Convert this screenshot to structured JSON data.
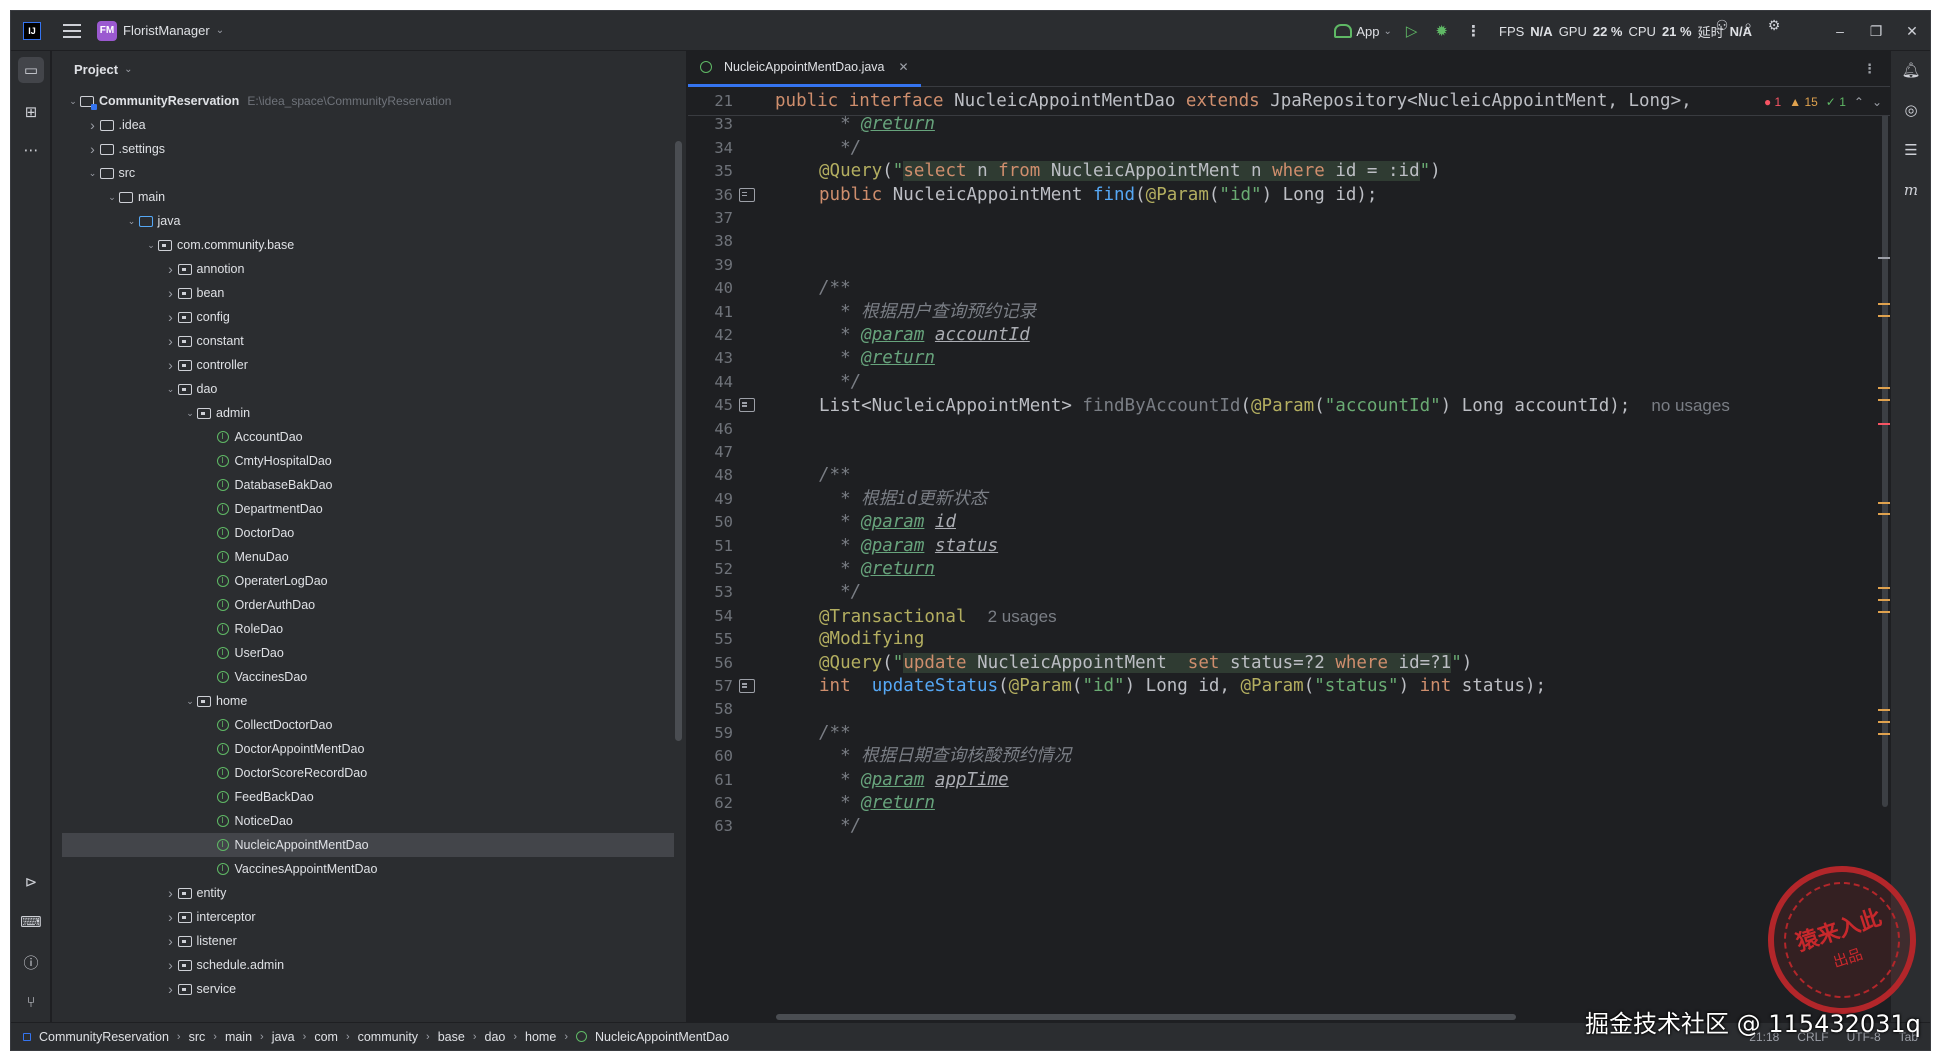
{
  "titlebar": {
    "logo_text": "IJ",
    "project_badge": "FM",
    "project_name": "FloristManager",
    "run_config": "App",
    "stats": {
      "fps_label": "FPS",
      "fps_value": "N/A",
      "gpu_label": "GPU",
      "gpu_value": "22 %",
      "cpu_label": "CPU",
      "cpu_value": "21 %",
      "latency_label": "延时",
      "latency_value": "N/A"
    }
  },
  "project_panel": {
    "title": "Project",
    "tree": [
      {
        "depth": 0,
        "arrow": "open",
        "icon": "module",
        "label": "CommunityReservation",
        "hint": "E:\\idea_space\\CommunityReservation",
        "bold": true
      },
      {
        "depth": 1,
        "arrow": "closed",
        "icon": "folder",
        "label": ".idea"
      },
      {
        "depth": 1,
        "arrow": "closed",
        "icon": "folder",
        "label": ".settings"
      },
      {
        "depth": 1,
        "arrow": "open",
        "icon": "folder",
        "label": "src"
      },
      {
        "depth": 2,
        "arrow": "open",
        "icon": "folder",
        "label": "main"
      },
      {
        "depth": 3,
        "arrow": "open",
        "icon": "source",
        "label": "java"
      },
      {
        "depth": 4,
        "arrow": "open",
        "icon": "package",
        "label": "com.community.base"
      },
      {
        "depth": 5,
        "arrow": "closed",
        "icon": "package",
        "label": "annotion"
      },
      {
        "depth": 5,
        "arrow": "closed",
        "icon": "package",
        "label": "bean"
      },
      {
        "depth": 5,
        "arrow": "closed",
        "icon": "package",
        "label": "config"
      },
      {
        "depth": 5,
        "arrow": "closed",
        "icon": "package",
        "label": "constant"
      },
      {
        "depth": 5,
        "arrow": "closed",
        "icon": "package",
        "label": "controller"
      },
      {
        "depth": 5,
        "arrow": "open",
        "icon": "package",
        "label": "dao"
      },
      {
        "depth": 6,
        "arrow": "open",
        "icon": "package",
        "label": "admin"
      },
      {
        "depth": 7,
        "arrow": "none",
        "icon": "interface",
        "label": "AccountDao"
      },
      {
        "depth": 7,
        "arrow": "none",
        "icon": "interface",
        "label": "CmtyHospitalDao"
      },
      {
        "depth": 7,
        "arrow": "none",
        "icon": "interface",
        "label": "DatabaseBakDao"
      },
      {
        "depth": 7,
        "arrow": "none",
        "icon": "interface",
        "label": "DepartmentDao"
      },
      {
        "depth": 7,
        "arrow": "none",
        "icon": "interface",
        "label": "DoctorDao"
      },
      {
        "depth": 7,
        "arrow": "none",
        "icon": "interface",
        "label": "MenuDao"
      },
      {
        "depth": 7,
        "arrow": "none",
        "icon": "interface",
        "label": "OperaterLogDao"
      },
      {
        "depth": 7,
        "arrow": "none",
        "icon": "interface",
        "label": "OrderAuthDao"
      },
      {
        "depth": 7,
        "arrow": "none",
        "icon": "interface",
        "label": "RoleDao"
      },
      {
        "depth": 7,
        "arrow": "none",
        "icon": "interface",
        "label": "UserDao"
      },
      {
        "depth": 7,
        "arrow": "none",
        "icon": "interface",
        "label": "VaccinesDao"
      },
      {
        "depth": 6,
        "arrow": "open",
        "icon": "package",
        "label": "home"
      },
      {
        "depth": 7,
        "arrow": "none",
        "icon": "interface",
        "label": "CollectDoctorDao"
      },
      {
        "depth": 7,
        "arrow": "none",
        "icon": "interface",
        "label": "DoctorAppointMentDao"
      },
      {
        "depth": 7,
        "arrow": "none",
        "icon": "interface",
        "label": "DoctorScoreRecordDao"
      },
      {
        "depth": 7,
        "arrow": "none",
        "icon": "interface",
        "label": "FeedBackDao"
      },
      {
        "depth": 7,
        "arrow": "none",
        "icon": "interface",
        "label": "NoticeDao"
      },
      {
        "depth": 7,
        "arrow": "none",
        "icon": "interface",
        "label": "NucleicAppointMentDao",
        "selected": true
      },
      {
        "depth": 7,
        "arrow": "none",
        "icon": "interface",
        "label": "VaccinesAppointMentDao"
      },
      {
        "depth": 5,
        "arrow": "closed",
        "icon": "package",
        "label": "entity"
      },
      {
        "depth": 5,
        "arrow": "closed",
        "icon": "package",
        "label": "interceptor"
      },
      {
        "depth": 5,
        "arrow": "closed",
        "icon": "package",
        "label": "listener"
      },
      {
        "depth": 5,
        "arrow": "closed",
        "icon": "package",
        "label": "schedule.admin"
      },
      {
        "depth": 5,
        "arrow": "closed",
        "icon": "package",
        "label": "service"
      }
    ]
  },
  "editor": {
    "tab_label": "NucleicAppointMentDao.java",
    "inspections": {
      "errors": "1",
      "warnings": "15",
      "ok": "1"
    },
    "lines": [
      {
        "n": "21",
        "sticky": true,
        "segs": [
          [
            "kw",
            "public interface "
          ],
          [
            "",
            "NucleicAppointMentDao "
          ],
          [
            "kw",
            "extends "
          ],
          [
            "",
            "JpaRepository<NucleicAppointMent, Long>, "
          ]
        ]
      },
      {
        "n": "33",
        "segs": [
          [
            "cmt",
            "  * "
          ],
          [
            "doctag",
            "@return"
          ]
        ]
      },
      {
        "n": "34",
        "segs": [
          [
            "cmt",
            "  */"
          ]
        ]
      },
      {
        "n": "35",
        "segs": [
          [
            "ann",
            "@Query"
          ],
          [
            "",
            "("
          ],
          [
            "str",
            "\""
          ],
          [
            "kw sql",
            "select "
          ],
          [
            "sql",
            "n "
          ],
          [
            "kw sql",
            "from "
          ],
          [
            "sql",
            "NucleicAppointMent n "
          ],
          [
            "kw sql",
            "where "
          ],
          [
            "sql",
            "id = :id"
          ],
          [
            "str",
            "\""
          ],
          [
            "",
            ")"
          ]
        ]
      },
      {
        "n": "36",
        "gmark": true,
        "segs": [
          [
            "kw",
            "public "
          ],
          [
            "",
            "NucleicAppointMent "
          ],
          [
            "fn",
            "find"
          ],
          [
            "",
            "("
          ],
          [
            "ann",
            "@Param"
          ],
          [
            "",
            "("
          ],
          [
            "str",
            "\"id\""
          ],
          [
            "",
            ") Long id);"
          ]
        ]
      },
      {
        "n": "37",
        "segs": []
      },
      {
        "n": "38",
        "segs": []
      },
      {
        "n": "39",
        "segs": []
      },
      {
        "n": "40",
        "segs": [
          [
            "cmt",
            "/**"
          ]
        ]
      },
      {
        "n": "41",
        "segs": [
          [
            "cmt",
            "  * 根据用户查询预约记录"
          ]
        ]
      },
      {
        "n": "42",
        "segs": [
          [
            "cmt",
            "  * "
          ],
          [
            "doctag",
            "@param"
          ],
          [
            "cmt",
            " "
          ],
          [
            "docparam",
            "accountId"
          ]
        ]
      },
      {
        "n": "43",
        "segs": [
          [
            "cmt",
            "  * "
          ],
          [
            "doctag",
            "@return"
          ]
        ]
      },
      {
        "n": "44",
        "segs": [
          [
            "cmt",
            "  */"
          ]
        ]
      },
      {
        "n": "45",
        "gmark": true,
        "segs": [
          [
            "",
            "List<NucleicAppointMent> "
          ],
          [
            "cmt-plain",
            "findByAccountId"
          ],
          [
            "",
            "("
          ],
          [
            "ann",
            "@Param"
          ],
          [
            "",
            "("
          ],
          [
            "str",
            "\"accountId\""
          ],
          [
            "",
            ") Long accountId);  "
          ],
          [
            "usage",
            "no usages"
          ]
        ]
      },
      {
        "n": "46",
        "segs": []
      },
      {
        "n": "47",
        "segs": []
      },
      {
        "n": "48",
        "segs": [
          [
            "cmt",
            "/**"
          ]
        ]
      },
      {
        "n": "49",
        "segs": [
          [
            "cmt",
            "  * 根据id更新状态"
          ]
        ]
      },
      {
        "n": "50",
        "segs": [
          [
            "cmt",
            "  * "
          ],
          [
            "doctag",
            "@param"
          ],
          [
            "cmt",
            " "
          ],
          [
            "docparam",
            "id"
          ]
        ]
      },
      {
        "n": "51",
        "segs": [
          [
            "cmt",
            "  * "
          ],
          [
            "doctag",
            "@param"
          ],
          [
            "cmt",
            " "
          ],
          [
            "docparam",
            "status"
          ]
        ]
      },
      {
        "n": "52",
        "segs": [
          [
            "cmt",
            "  * "
          ],
          [
            "doctag",
            "@return"
          ]
        ]
      },
      {
        "n": "53",
        "segs": [
          [
            "cmt",
            "  */"
          ]
        ]
      },
      {
        "n": "54",
        "segs": [
          [
            "ann",
            "@Transactional  "
          ],
          [
            "usage",
            "2 usages"
          ]
        ]
      },
      {
        "n": "55",
        "segs": [
          [
            "ann",
            "@Modifying"
          ]
        ]
      },
      {
        "n": "56",
        "segs": [
          [
            "ann",
            "@Query"
          ],
          [
            "",
            "("
          ],
          [
            "str",
            "\""
          ],
          [
            "kw sql",
            "update "
          ],
          [
            "sql",
            "NucleicAppointMent  "
          ],
          [
            "kw sql",
            "set "
          ],
          [
            "sql",
            "status=?2 "
          ],
          [
            "kw sql",
            "where "
          ],
          [
            "sql",
            "id=?1"
          ],
          [
            "str",
            "\""
          ],
          [
            "",
            ")"
          ]
        ]
      },
      {
        "n": "57",
        "gmark": true,
        "segs": [
          [
            "kw",
            "int  "
          ],
          [
            "fn",
            "updateStatus"
          ],
          [
            "",
            "("
          ],
          [
            "ann",
            "@Param"
          ],
          [
            "",
            "("
          ],
          [
            "str",
            "\"id\""
          ],
          [
            "",
            ") Long id, "
          ],
          [
            "ann",
            "@Param"
          ],
          [
            "",
            "("
          ],
          [
            "str",
            "\"status\""
          ],
          [
            "",
            ") "
          ],
          [
            "kw",
            "int "
          ],
          [
            "",
            "status);"
          ]
        ]
      },
      {
        "n": "58",
        "segs": []
      },
      {
        "n": "59",
        "segs": [
          [
            "cmt",
            "/**"
          ]
        ]
      },
      {
        "n": "60",
        "segs": [
          [
            "cmt",
            "  * 根据日期查询核酸预约情况"
          ]
        ]
      },
      {
        "n": "61",
        "segs": [
          [
            "cmt",
            "  * "
          ],
          [
            "doctag",
            "@param"
          ],
          [
            "cmt",
            " "
          ],
          [
            "docparam",
            "appTime"
          ]
        ]
      },
      {
        "n": "62",
        "segs": [
          [
            "cmt",
            "  * "
          ],
          [
            "doctag",
            "@return"
          ]
        ]
      },
      {
        "n": "63",
        "segs": [
          [
            "cmt",
            "  */"
          ]
        ]
      }
    ]
  },
  "breadcrumbs": [
    "CommunityReservation",
    "src",
    "main",
    "java",
    "com",
    "community",
    "base",
    "dao",
    "home",
    "NucleicAppointMentDao"
  ],
  "status_right": {
    "position": "21:18",
    "line_sep": "CRLF",
    "encoding": "UTF-8",
    "indent": "Tab"
  },
  "watermarks": {
    "stamp_main": "猿来入此",
    "stamp_sub": "出品",
    "site_text": "掘金技术社区 @ 115432031q"
  },
  "colors": {
    "accent": "#3574f0",
    "keyword": "#cf8e6d",
    "annotation": "#b3ae60",
    "string": "#6aab73",
    "function": "#56a8f5",
    "comment": "#7a7e85"
  }
}
